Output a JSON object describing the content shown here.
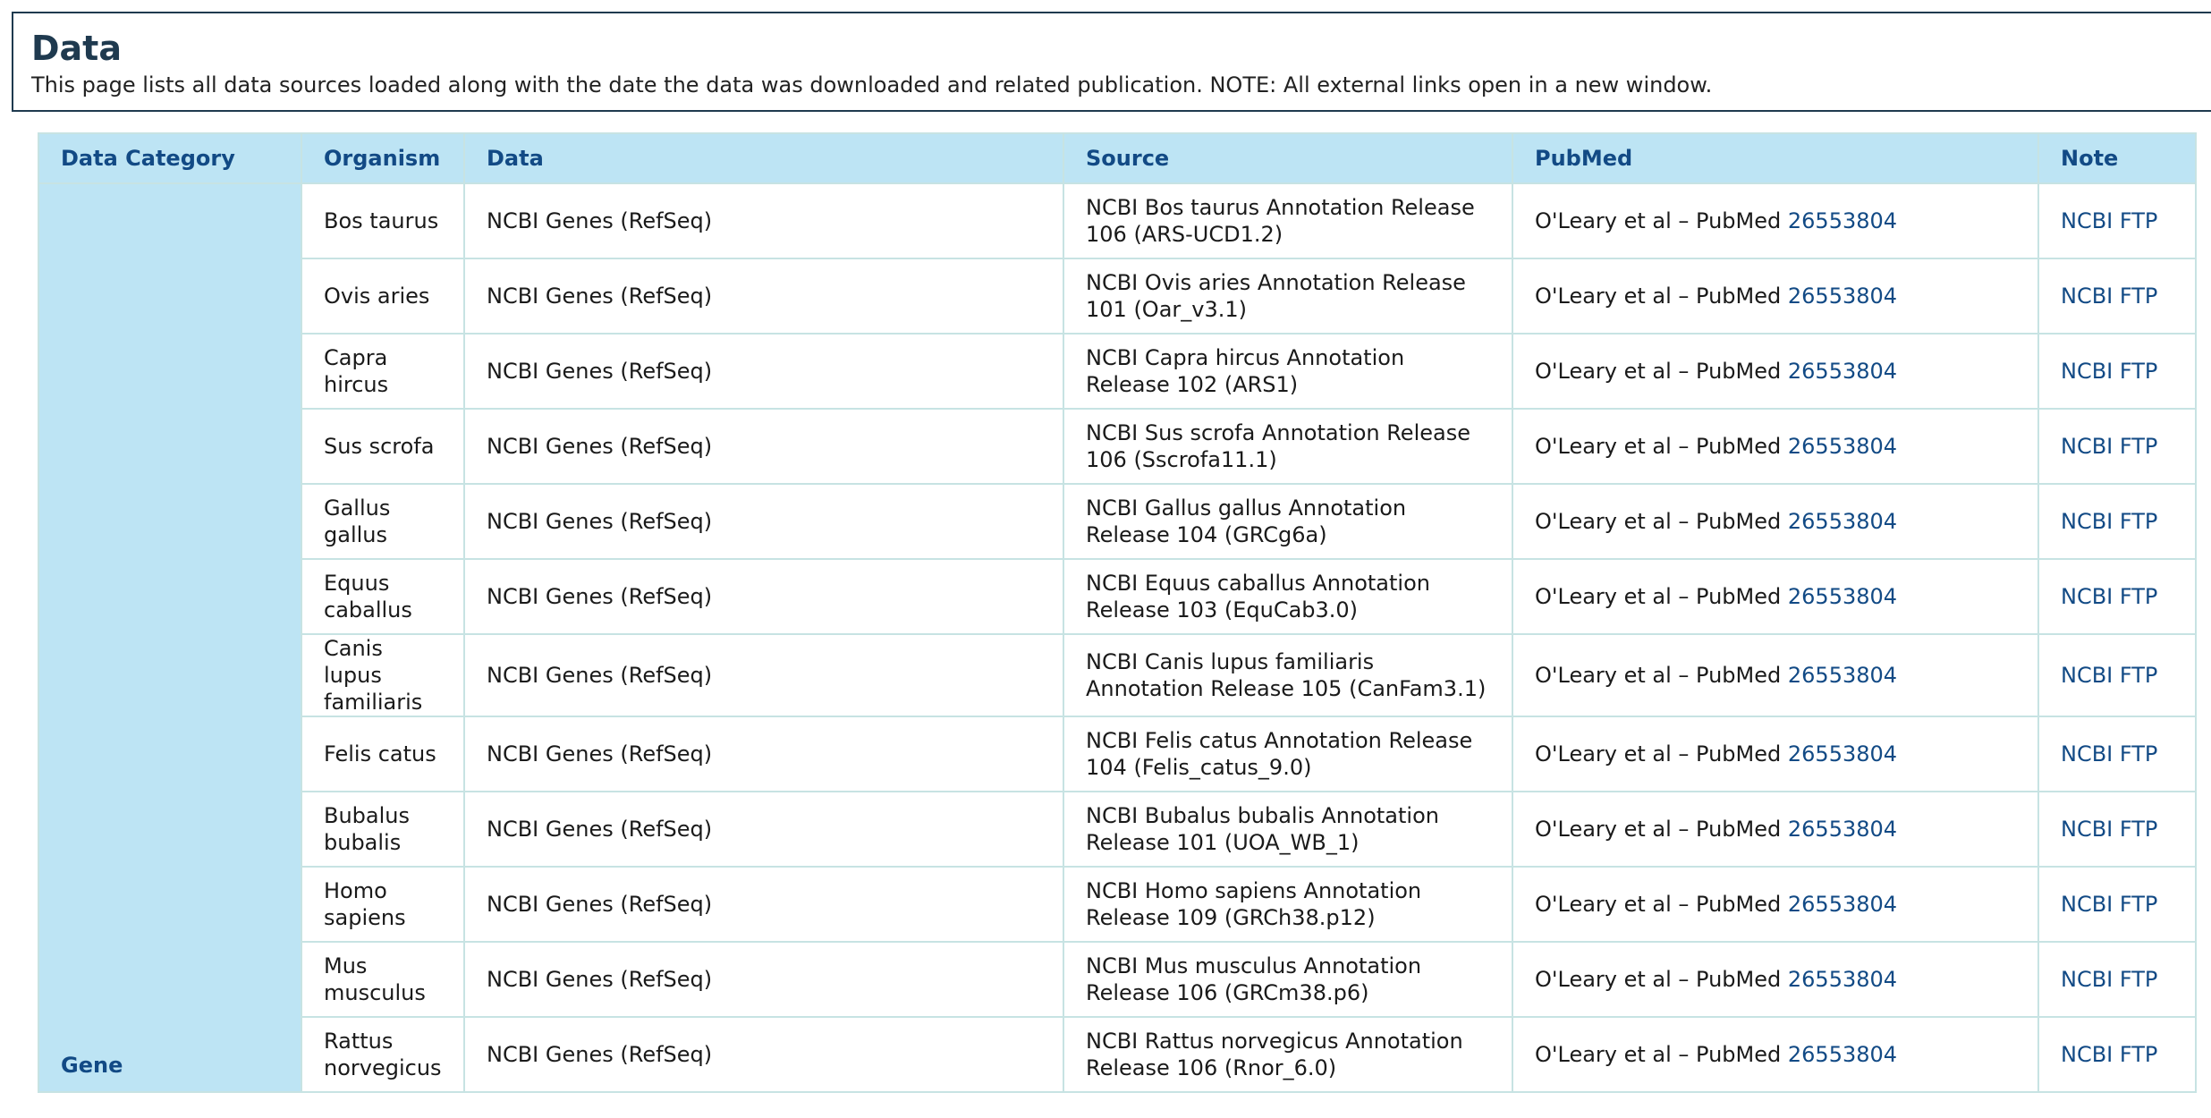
{
  "page": {
    "title": "Data",
    "description": "This page lists all data sources loaded along with the date the data was downloaded and related publication. NOTE: All external links open in a new window."
  },
  "table": {
    "headers": {
      "category": "Data Category",
      "organism": "Organism",
      "data": "Data",
      "source": "Source",
      "pubmed": "PubMed",
      "note": "Note"
    },
    "category_label": "Gene",
    "rows": [
      {
        "organism": "Bos taurus",
        "data": "NCBI Genes (RefSeq)",
        "source": "NCBI Bos taurus Annotation Release 106 (ARS-UCD1.2)",
        "pubmed_text": "O'Leary et al – PubMed",
        "pubmed_id": "26553804",
        "note": "NCBI FTP"
      },
      {
        "organism": "Ovis aries",
        "data": "NCBI Genes (RefSeq)",
        "source": "NCBI Ovis aries Annotation Release 101 (Oar_v3.1)",
        "pubmed_text": "O'Leary et al – PubMed",
        "pubmed_id": "26553804",
        "note": "NCBI FTP"
      },
      {
        "organism": "Capra hircus",
        "data": "NCBI Genes (RefSeq)",
        "source": "NCBI Capra hircus Annotation Release 102 (ARS1)",
        "pubmed_text": "O'Leary et al – PubMed",
        "pubmed_id": "26553804",
        "note": "NCBI FTP"
      },
      {
        "organism": "Sus scrofa",
        "data": "NCBI Genes (RefSeq)",
        "source": "NCBI Sus scrofa Annotation Release 106 (Sscrofa11.1)",
        "pubmed_text": "O'Leary et al – PubMed",
        "pubmed_id": "26553804",
        "note": "NCBI FTP"
      },
      {
        "organism": "Gallus gallus",
        "data": "NCBI Genes (RefSeq)",
        "source": "NCBI Gallus gallus Annotation Release 104 (GRCg6a)",
        "pubmed_text": "O'Leary et al – PubMed",
        "pubmed_id": "26553804",
        "note": "NCBI FTP"
      },
      {
        "organism": "Equus caballus",
        "data": "NCBI Genes (RefSeq)",
        "source": "NCBI Equus caballus Annotation Release 103 (EquCab3.0)",
        "pubmed_text": "O'Leary et al – PubMed",
        "pubmed_id": "26553804",
        "note": "NCBI FTP"
      },
      {
        "organism": "Canis lupus familiaris",
        "data": "NCBI Genes (RefSeq)",
        "source": "NCBI Canis lupus familiaris Annotation Release 105 (CanFam3.1)",
        "pubmed_text": "O'Leary et al – PubMed",
        "pubmed_id": "26553804",
        "note": "NCBI FTP"
      },
      {
        "organism": "Felis catus",
        "data": "NCBI Genes (RefSeq)",
        "source": "NCBI Felis catus Annotation Release 104 (Felis_catus_9.0)",
        "pubmed_text": "O'Leary et al – PubMed",
        "pubmed_id": "26553804",
        "note": "NCBI FTP"
      },
      {
        "organism": "Bubalus bubalis",
        "data": "NCBI Genes (RefSeq)",
        "source": "NCBI Bubalus bubalis Annotation Release 101 (UOA_WB_1)",
        "pubmed_text": "O'Leary et al – PubMed",
        "pubmed_id": "26553804",
        "note": "NCBI FTP"
      },
      {
        "organism": "Homo sapiens",
        "data": "NCBI Genes (RefSeq)",
        "source": "NCBI Homo sapiens Annotation Release 109 (GRCh38.p12)",
        "pubmed_text": "O'Leary et al – PubMed",
        "pubmed_id": "26553804",
        "note": "NCBI FTP"
      },
      {
        "organism": "Mus musculus",
        "data": "NCBI Genes (RefSeq)",
        "source": "NCBI Mus musculus Annotation Release 106 (GRCm38.p6)",
        "pubmed_text": "O'Leary et al – PubMed",
        "pubmed_id": "26553804",
        "note": "NCBI FTP"
      },
      {
        "organism": "Rattus norvegicus",
        "data": "NCBI Genes (RefSeq)",
        "source": "NCBI Rattus norvegicus Annotation Release 106 (Rnor_6.0)",
        "pubmed_text": "O'Leary et al – PubMed",
        "pubmed_id": "26553804",
        "note": "NCBI FTP"
      }
    ]
  }
}
